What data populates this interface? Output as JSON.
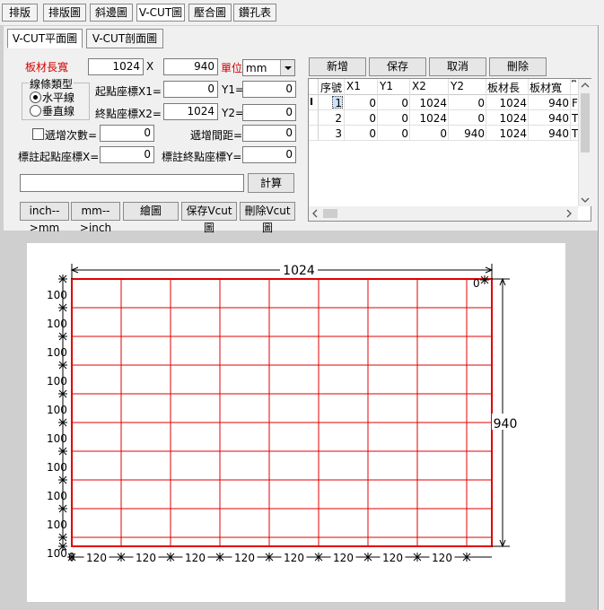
{
  "top_tabs": [
    "排版",
    "排版圖",
    "斜邊圖",
    "V-CUT圖",
    "壓合圖",
    "鑽孔表"
  ],
  "sub_tabs": [
    "V-CUT平面圖",
    "V-CUT剖面圖"
  ],
  "form": {
    "board_size_label": "板材長寬",
    "board_length": "1024",
    "times_sign": "X",
    "board_width": "940",
    "unit_label": "單位",
    "unit_value": "mm",
    "line_type_label": "線條類型",
    "horizontal_label": "水平線",
    "vertical_label": "垂直線",
    "start_x_label": "起點座標X1=",
    "start_x": "0",
    "y1_label": "Y1=",
    "y1": "0",
    "end_x_label": "終點座標X2=",
    "end_x": "1024",
    "y2_label": "Y2=",
    "y2": "0",
    "increment_count_label": "遞增次數=",
    "increment_count": "0",
    "increment_spacing_label": "遞增間距=",
    "increment_spacing": "0",
    "label_start_x_label": "標註起點座標X=",
    "label_start_x": "0",
    "label_end_y_label": "標註終點座標Y=",
    "label_end_y": "0",
    "expression": "",
    "calc_label": "計算"
  },
  "buttons": {
    "inch_mm": "inch-->mm",
    "mm_inch": "mm-->inch",
    "draw": "繪圖",
    "save_vcut": "保存Vcut圖",
    "delete_vcut": "刪除Vcut圖",
    "add": "新增",
    "save": "保存",
    "cancel": "取消",
    "delete": "刪除"
  },
  "table": {
    "columns": [
      "序號",
      "X1",
      "Y1",
      "X2",
      "Y2",
      "板材長",
      "板材寬",
      "⎴"
    ],
    "rows": [
      [
        "1",
        "0",
        "0",
        "1024",
        "0",
        "1024",
        "940",
        "F"
      ],
      [
        "2",
        "0",
        "0",
        "1024",
        "0",
        "1024",
        "940",
        "T"
      ],
      [
        "3",
        "0",
        "0",
        "0",
        "940",
        "1024",
        "940",
        "T"
      ]
    ]
  },
  "drawing": {
    "board_length_label": "1024",
    "board_width_label": "940",
    "corner_label": "0",
    "origin_label": "0",
    "row_spacing_label": "100",
    "col_spacing_label": "120",
    "row_count": 9,
    "col_count": 8,
    "grid_color": "#e00000"
  }
}
